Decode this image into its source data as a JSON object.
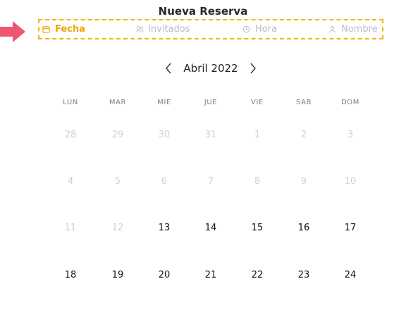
{
  "header": {
    "title": "Nueva Reserva"
  },
  "steps": [
    {
      "label": "Fecha",
      "icon": "calendar-icon",
      "active": true
    },
    {
      "label": "Invitados",
      "icon": "users-icon",
      "active": false
    },
    {
      "label": "Hora",
      "icon": "clock-icon",
      "active": false
    },
    {
      "label": "Nombre",
      "icon": "user-icon",
      "active": false
    }
  ],
  "calendar": {
    "month_label": "Abril 2022",
    "weekdays": [
      "LUN",
      "MAR",
      "MIE",
      "JUE",
      "VIE",
      "SAB",
      "DOM"
    ],
    "weeks": [
      [
        {
          "d": "28",
          "muted": true
        },
        {
          "d": "29",
          "muted": true
        },
        {
          "d": "30",
          "muted": true
        },
        {
          "d": "31",
          "muted": true
        },
        {
          "d": "1",
          "muted": true
        },
        {
          "d": "2",
          "muted": true
        },
        {
          "d": "3",
          "muted": true
        }
      ],
      [
        {
          "d": "4",
          "muted": true
        },
        {
          "d": "5",
          "muted": true
        },
        {
          "d": "6",
          "muted": true
        },
        {
          "d": "7",
          "muted": true
        },
        {
          "d": "8",
          "muted": true
        },
        {
          "d": "9",
          "muted": true
        },
        {
          "d": "10",
          "muted": true
        }
      ],
      [
        {
          "d": "11",
          "muted": true
        },
        {
          "d": "12",
          "muted": true
        },
        {
          "d": "13",
          "muted": false
        },
        {
          "d": "14",
          "muted": false
        },
        {
          "d": "15",
          "muted": false
        },
        {
          "d": "16",
          "muted": false
        },
        {
          "d": "17",
          "muted": false
        }
      ],
      [
        {
          "d": "18",
          "muted": false
        },
        {
          "d": "19",
          "muted": false
        },
        {
          "d": "20",
          "muted": false
        },
        {
          "d": "21",
          "muted": false
        },
        {
          "d": "22",
          "muted": false
        },
        {
          "d": "23",
          "muted": false
        },
        {
          "d": "24",
          "muted": false
        }
      ]
    ]
  },
  "colors": {
    "accent": "#f1a400",
    "highlight_border": "#f2b600",
    "pointer": "#f0566f",
    "muted_day": "#c9d2de"
  }
}
